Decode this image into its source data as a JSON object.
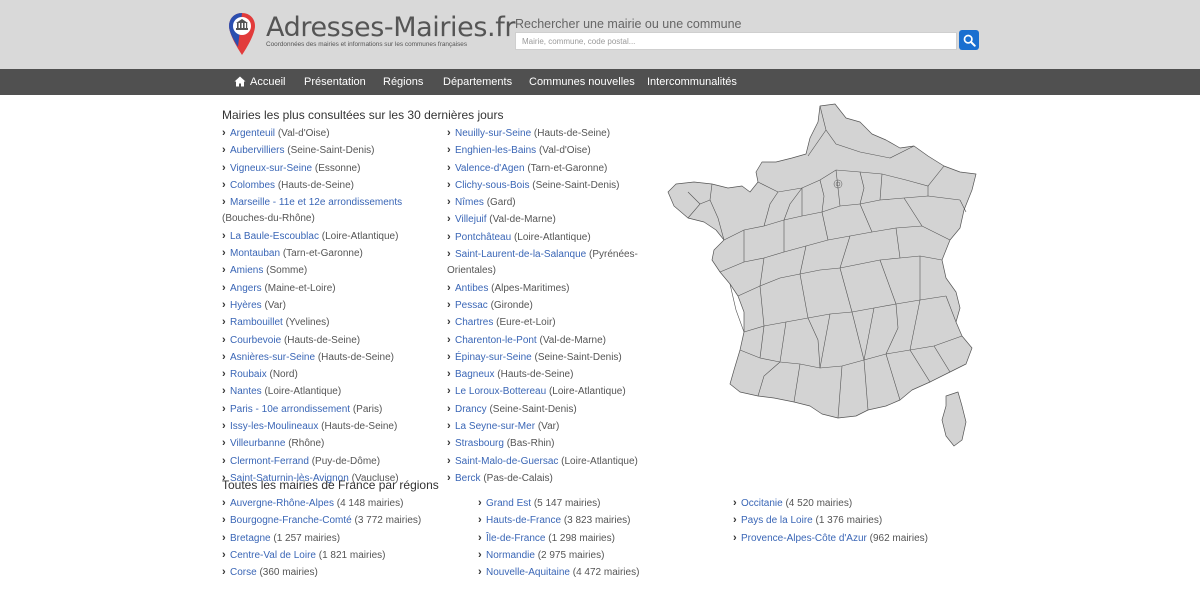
{
  "header": {
    "site_title": "Adresses-Mairies.fr",
    "tagline": "Coordonnées des mairies et informations sur les communes françaises",
    "search_label": "Rechercher une mairie ou une commune",
    "search_placeholder": "Mairie, commune, code postal...",
    "search_icon": "search-icon"
  },
  "nav": {
    "items": [
      {
        "label": "Accueil",
        "icon": "home-icon"
      },
      {
        "label": "Présentation"
      },
      {
        "label": "Régions"
      },
      {
        "label": "Départements"
      },
      {
        "label": "Communes nouvelles"
      },
      {
        "label": "Intercommunalités"
      }
    ]
  },
  "popular": {
    "title": "Mairies les plus consultées sur les 30 dernières jours",
    "left": [
      {
        "name": "Argenteuil",
        "ctx": "(Val-d'Oise)"
      },
      {
        "name": "Aubervilliers",
        "ctx": "(Seine-Saint-Denis)"
      },
      {
        "name": "Vigneux-sur-Seine",
        "ctx": "(Essonne)"
      },
      {
        "name": "Colombes",
        "ctx": "(Hauts-de-Seine)"
      },
      {
        "name": "Marseille - 11e et 12e arrondissements",
        "ctx": "(Bouches-du-Rhône)"
      },
      {
        "name": "La Baule-Escoublac",
        "ctx": "(Loire-Atlantique)"
      },
      {
        "name": "Montauban",
        "ctx": "(Tarn-et-Garonne)"
      },
      {
        "name": "Amiens",
        "ctx": "(Somme)"
      },
      {
        "name": "Angers",
        "ctx": "(Maine-et-Loire)"
      },
      {
        "name": "Hyères",
        "ctx": "(Var)"
      },
      {
        "name": "Rambouillet",
        "ctx": "(Yvelines)"
      },
      {
        "name": "Courbevoie",
        "ctx": "(Hauts-de-Seine)"
      },
      {
        "name": "Asnières-sur-Seine",
        "ctx": "(Hauts-de-Seine)"
      },
      {
        "name": "Roubaix",
        "ctx": "(Nord)"
      },
      {
        "name": "Nantes",
        "ctx": "(Loire-Atlantique)"
      },
      {
        "name": "Paris - 10e arrondissement",
        "ctx": "(Paris)"
      },
      {
        "name": "Issy-les-Moulineaux",
        "ctx": "(Hauts-de-Seine)"
      },
      {
        "name": "Villeurbanne",
        "ctx": "(Rhône)"
      },
      {
        "name": "Clermont-Ferrand",
        "ctx": "(Puy-de-Dôme)"
      },
      {
        "name": "Saint-Saturnin-lès-Avignon",
        "ctx": "(Vaucluse)"
      }
    ],
    "right": [
      {
        "name": "Neuilly-sur-Seine",
        "ctx": "(Hauts-de-Seine)"
      },
      {
        "name": "Enghien-les-Bains",
        "ctx": "(Val-d'Oise)"
      },
      {
        "name": "Valence-d'Agen",
        "ctx": "(Tarn-et-Garonne)"
      },
      {
        "name": "Clichy-sous-Bois",
        "ctx": "(Seine-Saint-Denis)"
      },
      {
        "name": "Nîmes",
        "ctx": "(Gard)"
      },
      {
        "name": "Villejuif",
        "ctx": "(Val-de-Marne)"
      },
      {
        "name": "Pontchâteau",
        "ctx": "(Loire-Atlantique)"
      },
      {
        "name": "Saint-Laurent-de-la-Salanque",
        "ctx": "(Pyrénées-Orientales)"
      },
      {
        "name": "Antibes",
        "ctx": "(Alpes-Maritimes)"
      },
      {
        "name": "Pessac",
        "ctx": "(Gironde)"
      },
      {
        "name": "Chartres",
        "ctx": "(Eure-et-Loir)"
      },
      {
        "name": "Charenton-le-Pont",
        "ctx": "(Val-de-Marne)"
      },
      {
        "name": "Épinay-sur-Seine",
        "ctx": "(Seine-Saint-Denis)"
      },
      {
        "name": "Bagneux",
        "ctx": "(Hauts-de-Seine)"
      },
      {
        "name": "Le Loroux-Bottereau",
        "ctx": "(Loire-Atlantique)"
      },
      {
        "name": "Drancy",
        "ctx": "(Seine-Saint-Denis)"
      },
      {
        "name": "La Seyne-sur-Mer",
        "ctx": "(Var)"
      },
      {
        "name": "Strasbourg",
        "ctx": "(Bas-Rhin)"
      },
      {
        "name": "Saint-Malo-de-Guersac",
        "ctx": "(Loire-Atlantique)"
      },
      {
        "name": "Berck",
        "ctx": "(Pas-de-Calais)"
      }
    ]
  },
  "regions": {
    "title": "Toutes les mairies de France par régions",
    "col1": [
      {
        "name": "Auvergne-Rhône-Alpes",
        "ctx": "(4 148 mairies)"
      },
      {
        "name": "Bourgogne-Franche-Comté",
        "ctx": "(3 772 mairies)"
      },
      {
        "name": "Bretagne",
        "ctx": "(1 257 mairies)"
      },
      {
        "name": "Centre-Val de Loire",
        "ctx": "(1 821 mairies)"
      },
      {
        "name": "Corse",
        "ctx": "(360 mairies)"
      }
    ],
    "col2": [
      {
        "name": "Grand Est",
        "ctx": "(5 147 mairies)"
      },
      {
        "name": "Hauts-de-France",
        "ctx": "(3 823 mairies)"
      },
      {
        "name": "Île-de-France",
        "ctx": "(1 298 mairies)"
      },
      {
        "name": "Normandie",
        "ctx": "(2 975 mairies)"
      },
      {
        "name": "Nouvelle-Aquitaine",
        "ctx": "(4 472 mairies)"
      }
    ],
    "col3": [
      {
        "name": "Occitanie",
        "ctx": "(4 520 mairies)"
      },
      {
        "name": "Pays de la Loire",
        "ctx": "(1 376 mairies)"
      },
      {
        "name": "Provence-Alpes-Côte d'Azur",
        "ctx": "(962 mairies)"
      }
    ]
  },
  "colors": {
    "link": "#3a66b6",
    "header_bg": "#d9d9d9",
    "nav_bg": "#505050",
    "map_fill": "#d3d3d3",
    "search_button": "#1a6fd0"
  }
}
